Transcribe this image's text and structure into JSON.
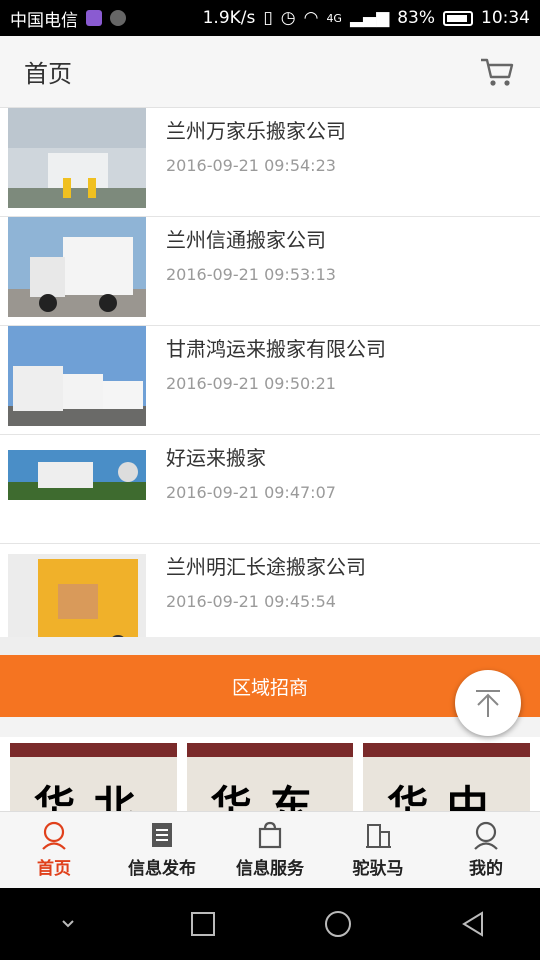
{
  "status_bar": {
    "carrier": "中国电信",
    "speed": "1.9K/s",
    "network": "4G",
    "battery": "83%",
    "time": "10:34"
  },
  "header": {
    "title": "首页",
    "cart_icon": "cart-icon"
  },
  "list": {
    "items": [
      {
        "title": "兰州万家乐搬家公司",
        "date": "2016-09-21 09:54:23"
      },
      {
        "title": "兰州信通搬家公司",
        "date": "2016-09-21 09:53:13"
      },
      {
        "title": "甘肃鸿运来搬家有限公司",
        "date": "2016-09-21 09:50:21"
      },
      {
        "title": "好运来搬家",
        "date": "2016-09-21 09:47:07"
      },
      {
        "title": "兰州明汇长途搬家公司",
        "date": "2016-09-21 09:45:54"
      }
    ]
  },
  "banner": {
    "label": "区域招商"
  },
  "regions": [
    {
      "label": "华北"
    },
    {
      "label": "华东"
    },
    {
      "label": "华中"
    }
  ],
  "tabbar": {
    "tabs": [
      {
        "label": "首页",
        "icon": "user-icon",
        "active": true
      },
      {
        "label": "信息发布",
        "icon": "document-icon"
      },
      {
        "label": "信息服务",
        "icon": "bag-icon"
      },
      {
        "label": "驼驮马",
        "icon": "building-icon"
      },
      {
        "label": "我的",
        "icon": "profile-icon"
      }
    ]
  },
  "colors": {
    "accent": "#f57421",
    "active_tab": "#e0401b"
  }
}
